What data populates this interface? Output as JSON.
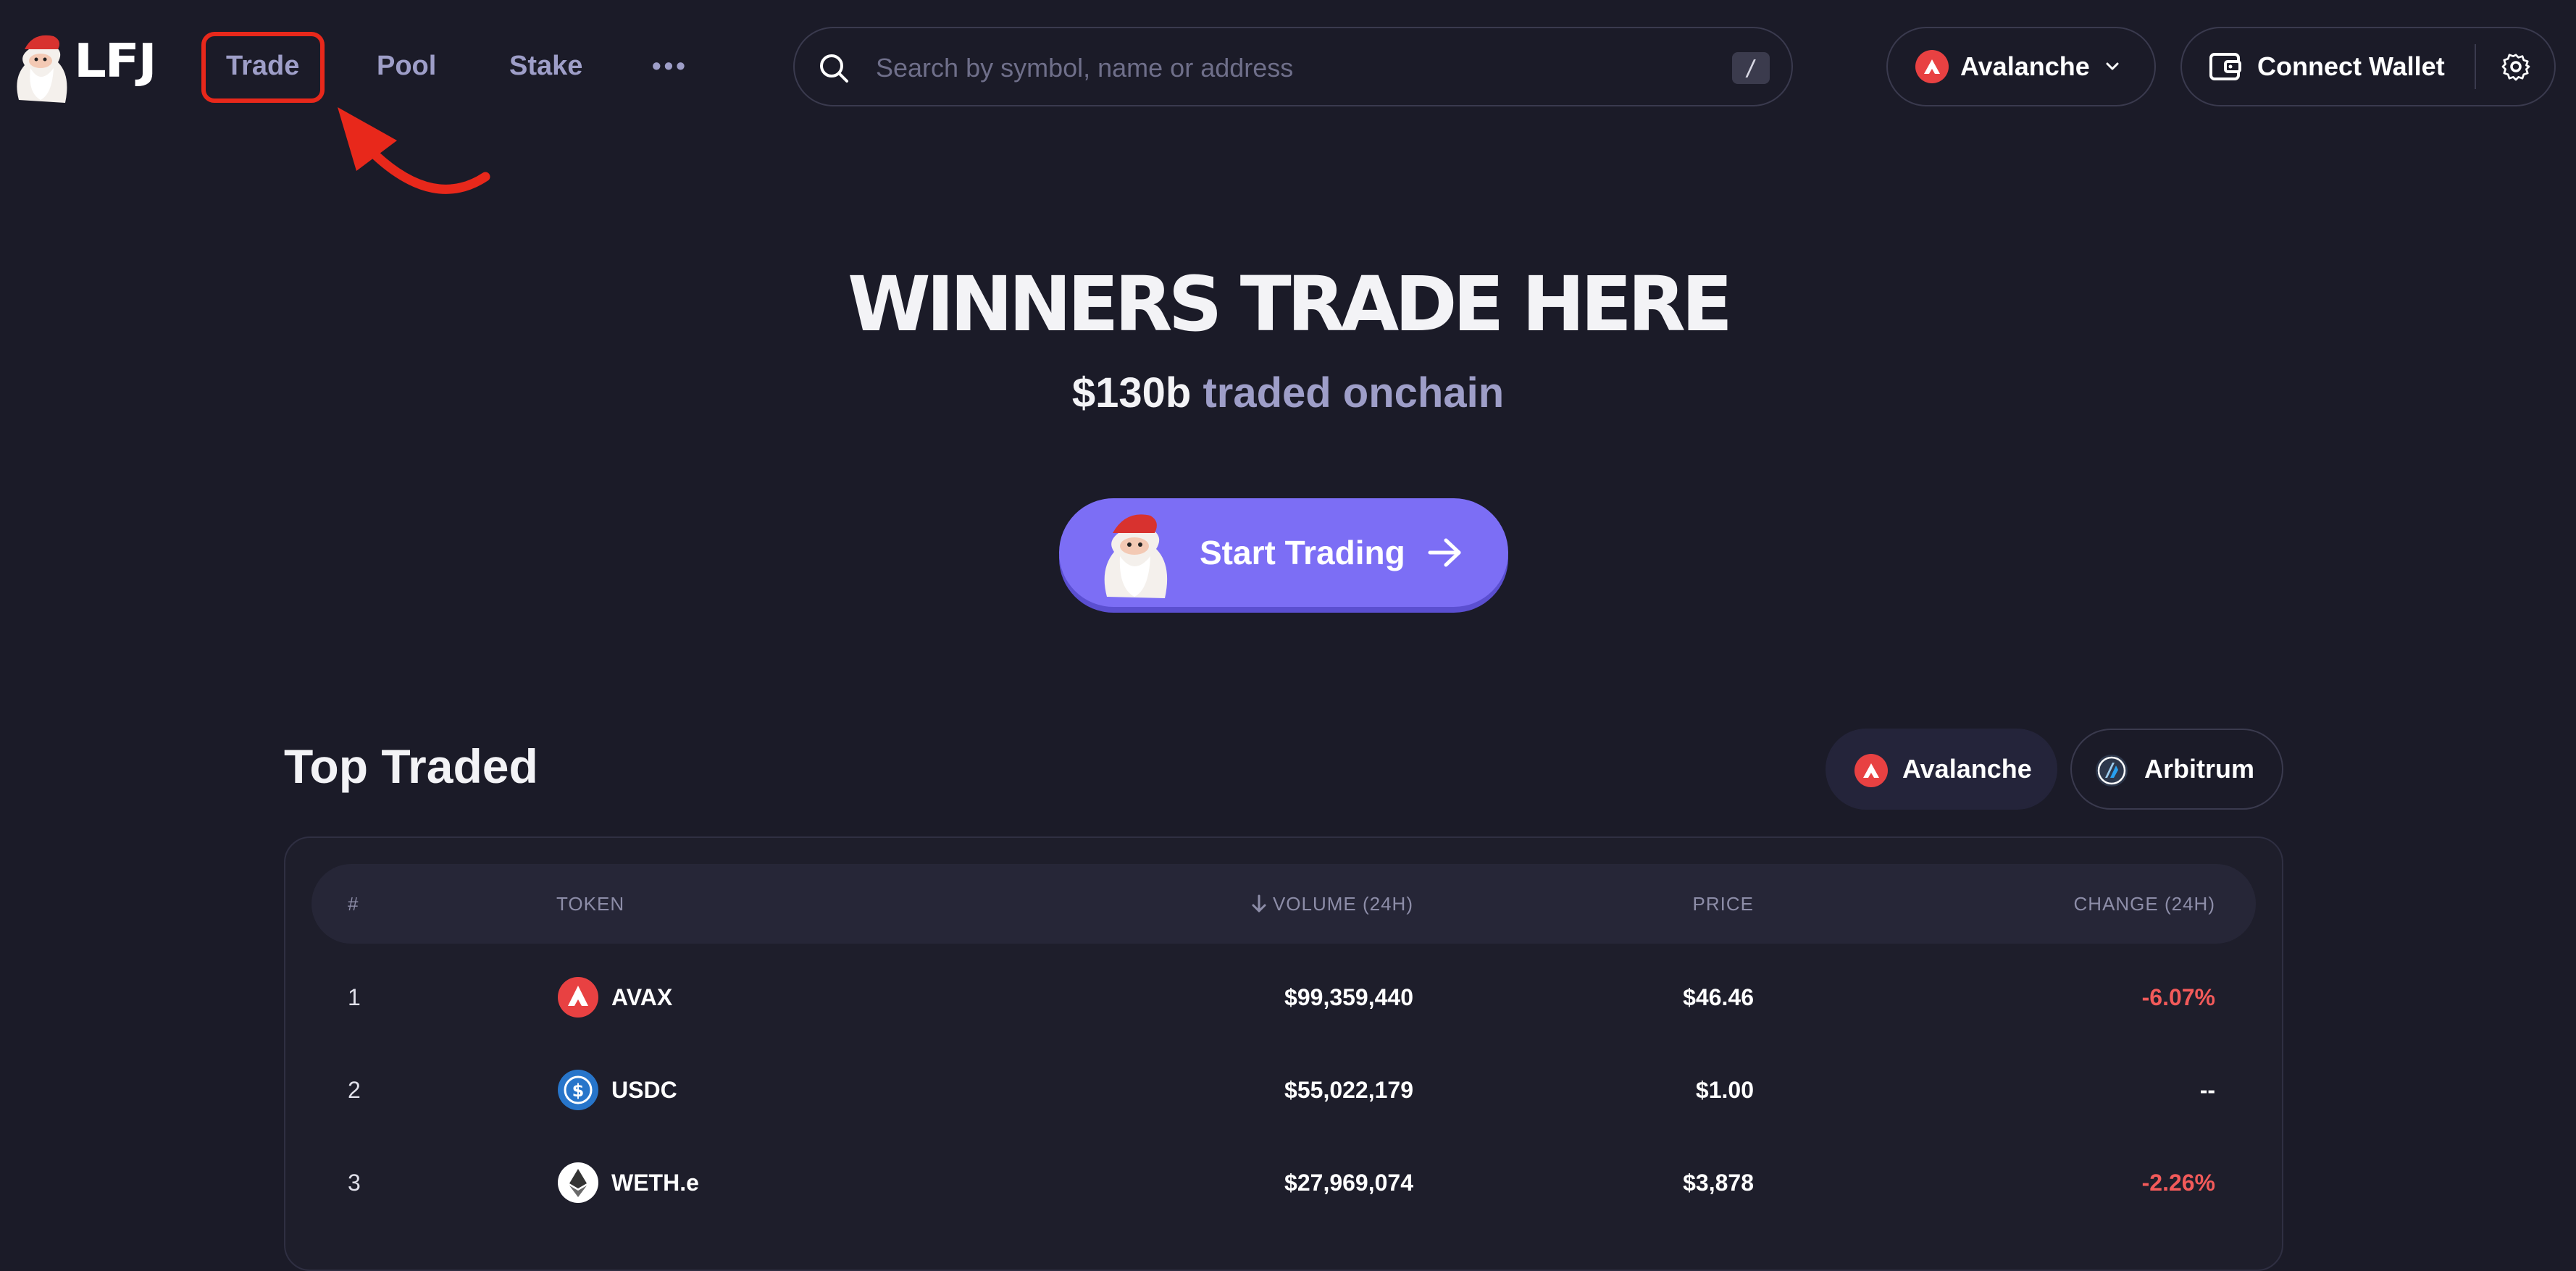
{
  "header": {
    "logo_text": "LFJ",
    "nav": {
      "trade": "Trade",
      "pool": "Pool",
      "stake": "Stake",
      "more": "•••"
    },
    "search": {
      "placeholder": "Search by symbol, name or address",
      "shortcut": "/"
    },
    "network": "Avalanche",
    "connect_wallet": "Connect Wallet"
  },
  "hero": {
    "title": "WINNERS TRADE HERE",
    "amount": "$130b",
    "subtitle_rest": "traded onchain",
    "cta": "Start Trading"
  },
  "top_traded": {
    "title": "Top Traded",
    "chains": [
      "Avalanche",
      "Arbitrum"
    ],
    "columns": {
      "num": "#",
      "token": "TOKEN",
      "volume": "VOLUME (24H)",
      "price": "PRICE",
      "change": "CHANGE (24H)"
    },
    "rows": [
      {
        "num": "1",
        "token": "AVAX",
        "volume": "$99,359,440",
        "price": "$46.46",
        "change": "-6.07%"
      },
      {
        "num": "2",
        "token": "USDC",
        "volume": "$55,022,179",
        "price": "$1.00",
        "change": "--"
      },
      {
        "num": "3",
        "token": "WETH.e",
        "volume": "$27,969,074",
        "price": "$3,878",
        "change": "-2.26%"
      }
    ]
  },
  "colors": {
    "background": "#1b1b28",
    "accent": "#7c6ef5",
    "nav_text": "#9e9ec8",
    "negative": "#f25a5a",
    "avalanche_red": "#e84142",
    "annotation_red": "#e8281b"
  }
}
